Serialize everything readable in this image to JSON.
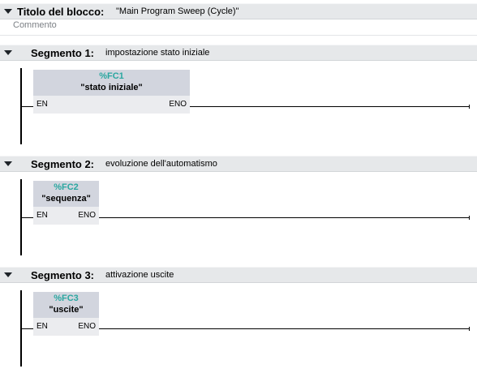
{
  "block": {
    "title_label": "Titolo del blocco:",
    "title_value": "\"Main Program Sweep (Cycle)\"",
    "comment_placeholder": "Commento"
  },
  "segments": [
    {
      "label": "Segmento 1:",
      "description": "impostazione stato iniziale",
      "fb_address": "%FC1",
      "fb_name": "\"stato iniziale\"",
      "en": "EN",
      "eno": "ENO"
    },
    {
      "label": "Segmento 2:",
      "description": "evoluzione dell'automatismo",
      "fb_address": "%FC2",
      "fb_name": "\"sequenza\"",
      "en": "EN",
      "eno": "ENO"
    },
    {
      "label": "Segmento 3:",
      "description": "attivazione uscite",
      "fb_address": "%FC3",
      "fb_name": "\"uscite\"",
      "en": "EN",
      "eno": "ENO"
    }
  ],
  "colors": {
    "header_bg": "#e6e8ea",
    "fb_header_bg": "#d2d5de",
    "fb_body_bg": "#ebecef",
    "fb_address": "#2aa7a0",
    "comment_text": "#7c8085"
  },
  "icons": {
    "collapse": "triangle-down-icon"
  }
}
